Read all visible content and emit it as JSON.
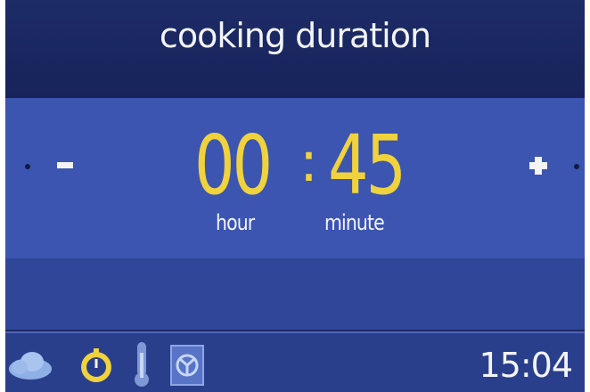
{
  "screen": {
    "title": "cooking duration"
  },
  "timer": {
    "hours": "00",
    "separator": ":",
    "minutes": "45",
    "hours_label": "hour",
    "minutes_label": "minute"
  },
  "controls": {
    "decrease_icon": "minus-icon",
    "increase_icon": "plus-icon"
  },
  "status_bar": {
    "icons": [
      "cloud-icon",
      "dial-icon",
      "thermometer-icon",
      "fan-icon"
    ],
    "clock": "15:04"
  },
  "colors": {
    "background": "#1b2a63",
    "highlight_band": "#3b55b0",
    "digits": "#f0d23c",
    "text": "#f3f4fb"
  }
}
